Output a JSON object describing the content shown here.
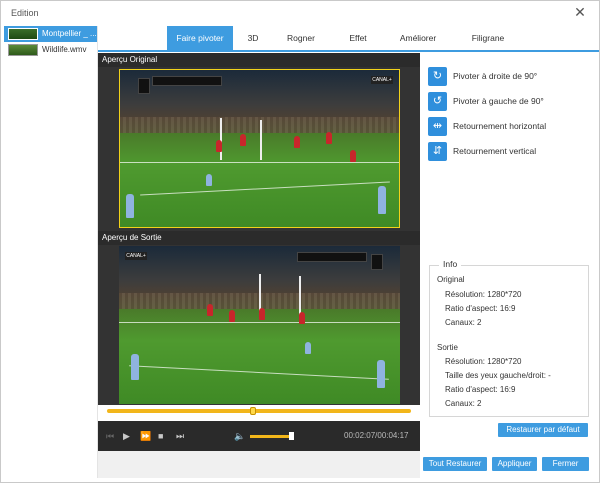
{
  "window": {
    "title": "Edition"
  },
  "files": [
    {
      "name": "Montpellier _ ...",
      "selected": true
    },
    {
      "name": "Wildlife.wmv",
      "selected": false
    }
  ],
  "tabs": [
    {
      "label": "Faire pivoter",
      "active": true
    },
    {
      "label": "3D",
      "active": false
    },
    {
      "label": "Rogner",
      "active": false
    },
    {
      "label": "Effet",
      "active": false
    },
    {
      "label": "Améliorer",
      "active": false
    },
    {
      "label": "Filigrane",
      "active": false
    }
  ],
  "preview": {
    "original_label": "Aperçu Original",
    "output_label": "Aperçu de Sortie",
    "channel_logo": "CANAL+",
    "progress": 0.48,
    "volume": 0.9,
    "time": "00:02:07/00:04:17"
  },
  "rotate": [
    {
      "label": "Pivoter à droite de 90°",
      "icon": "rotate-right-icon",
      "glyph": "↻"
    },
    {
      "label": "Pivoter à gauche de 90°",
      "icon": "rotate-left-icon",
      "glyph": "↺"
    },
    {
      "label": "Retournement horizontal",
      "icon": "flip-horizontal-icon",
      "glyph": "⇹"
    },
    {
      "label": "Retournement vertical",
      "icon": "flip-vertical-icon",
      "glyph": "⇵"
    }
  ],
  "info": {
    "legend": "Info",
    "original_title": "Original",
    "original_resolution": "Résolution: 1280*720",
    "original_ratio": "Ratio d'aspect: 16:9",
    "original_channels": "Canaux: 2",
    "output_title": "Sortie",
    "output_resolution": "Résolution: 1280*720",
    "output_eyes": "Taille des yeux gauche/droit: -",
    "output_ratio": "Ratio d'aspect: 16:9",
    "output_channels": "Canaux: 2"
  },
  "buttons": {
    "restore_default": "Restaurer par défaut",
    "restore_all": "Tout Restaurer",
    "apply": "Appliquer",
    "close": "Fermer"
  },
  "colors": {
    "accent": "#3e9ce0",
    "crop_border": "#f2d21a",
    "timeline": "#f2b61a"
  }
}
